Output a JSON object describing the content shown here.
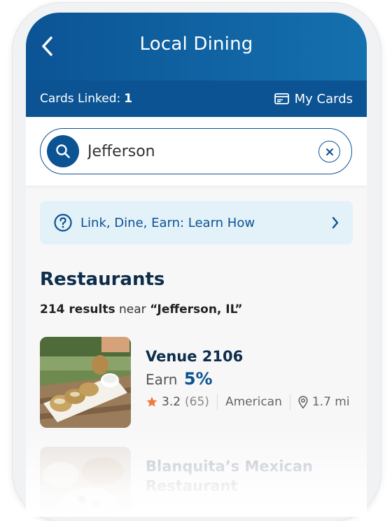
{
  "header": {
    "title": "Local Dining",
    "cards_linked_label": "Cards Linked:",
    "cards_linked_count": "1",
    "my_cards_label": "My Cards"
  },
  "search": {
    "value": "Jefferson",
    "placeholder": ""
  },
  "banner": {
    "label": "Link, Dine, Earn: Learn How"
  },
  "section": {
    "title": "Restaurants",
    "results_count": "214 results",
    "results_near": "near",
    "results_location": "“Jefferson, IL”"
  },
  "restaurants": [
    {
      "name": "Venue 2106",
      "earn_label": "Earn",
      "earn_percent": "5%",
      "rating": "3.2",
      "rating_count": "(65)",
      "cuisine": "American",
      "distance": "1.7 mi"
    },
    {
      "name": "Blanquita’s Mexican",
      "name_line2": "Restaurant"
    }
  ],
  "colors": {
    "primary": "#0b5393",
    "banner_bg": "#e3f1f9",
    "star": "#f07a3a"
  }
}
